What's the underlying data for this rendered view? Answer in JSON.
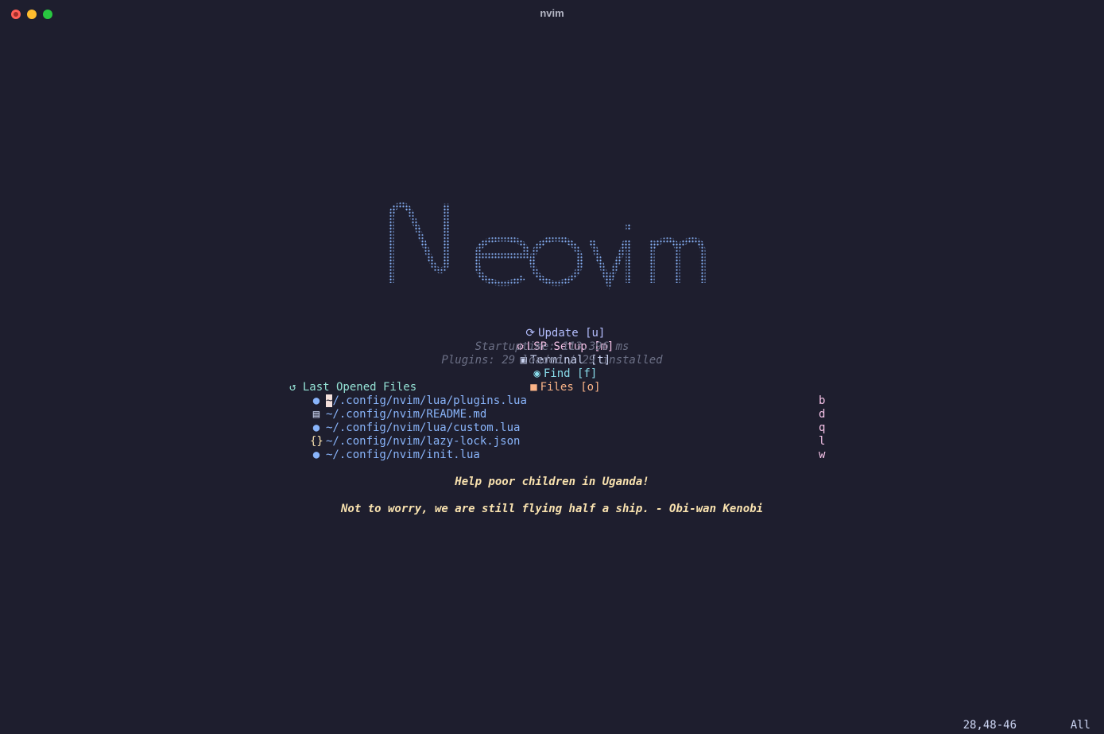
{
  "window": {
    "title": "nvim"
  },
  "logo": {
    "text": "Neovim",
    "color": "#89b4fa"
  },
  "buttons": [
    {
      "icon": "refresh-icon",
      "label": "Update [u]"
    },
    {
      "icon": "lsp-icon",
      "label": "LSP Setup [m]"
    },
    {
      "icon": "terminal-icon",
      "label": "Terminal [t]"
    },
    {
      "icon": "telescope-icon",
      "label": "Find [f]"
    },
    {
      "icon": "folder-icon",
      "label": "Files [o]"
    }
  ],
  "stats": {
    "startuptime": "Startuptime: 113.396 ms",
    "plugins": "Plugins: 29 loaded / 29 installed"
  },
  "recent": {
    "header": "Last Opened Files",
    "header_icon": "history-icon",
    "files": [
      {
        "icon": "lua-icon",
        "path_first": "~",
        "path_rest": "/.config/nvim/lua/plugins.lua",
        "key": "b"
      },
      {
        "icon": "markdown-icon",
        "path": "~/.config/nvim/README.md",
        "key": "d"
      },
      {
        "icon": "lua-icon",
        "path": "~/.config/nvim/lua/custom.lua",
        "key": "q"
      },
      {
        "icon": "json-icon",
        "path": "~/.config/nvim/lazy-lock.json",
        "key": "l"
      },
      {
        "icon": "lua-icon",
        "path": "~/.config/nvim/init.lua",
        "key": "w"
      }
    ]
  },
  "footer": {
    "line1": "Help poor children in Uganda!",
    "line2": "Not to worry, we are still flying half a ship. - Obi-wan Kenobi"
  },
  "statusline": {
    "position": "28,48-46",
    "scroll": "All"
  },
  "colors": {
    "background": "#1e1e2e",
    "accent": "#89b4fa",
    "footer": "#f9e2af"
  }
}
